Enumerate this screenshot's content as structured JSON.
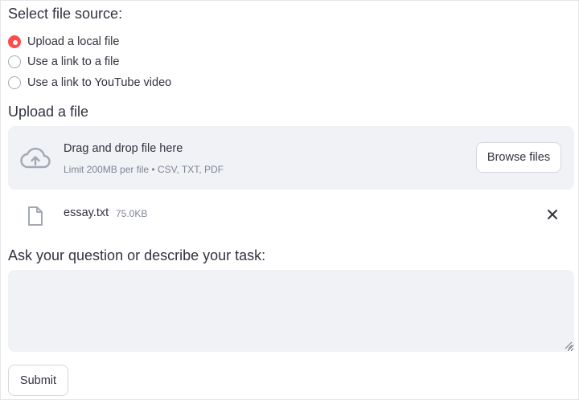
{
  "source": {
    "title": "Select file source:",
    "options": [
      {
        "label": "Upload a local file",
        "selected": true
      },
      {
        "label": "Use a link to a file",
        "selected": false
      },
      {
        "label": "Use a link to YouTube video",
        "selected": false
      }
    ]
  },
  "upload": {
    "title": "Upload a file",
    "dropzone_title": "Drag and drop file here",
    "dropzone_limit": "Limit 200MB per file • CSV, TXT, PDF",
    "browse_label": "Browse files",
    "file": {
      "name": "essay.txt",
      "size": "75.0KB"
    }
  },
  "question": {
    "title": "Ask your question or describe your task:",
    "value": ""
  },
  "submit_label": "Submit",
  "colors": {
    "accent": "#ff4b4b",
    "panel": "#f0f2f6",
    "icon": "#a3a8b4"
  },
  "icons": [
    "cloud-upload-icon",
    "file-icon",
    "close-icon"
  ]
}
